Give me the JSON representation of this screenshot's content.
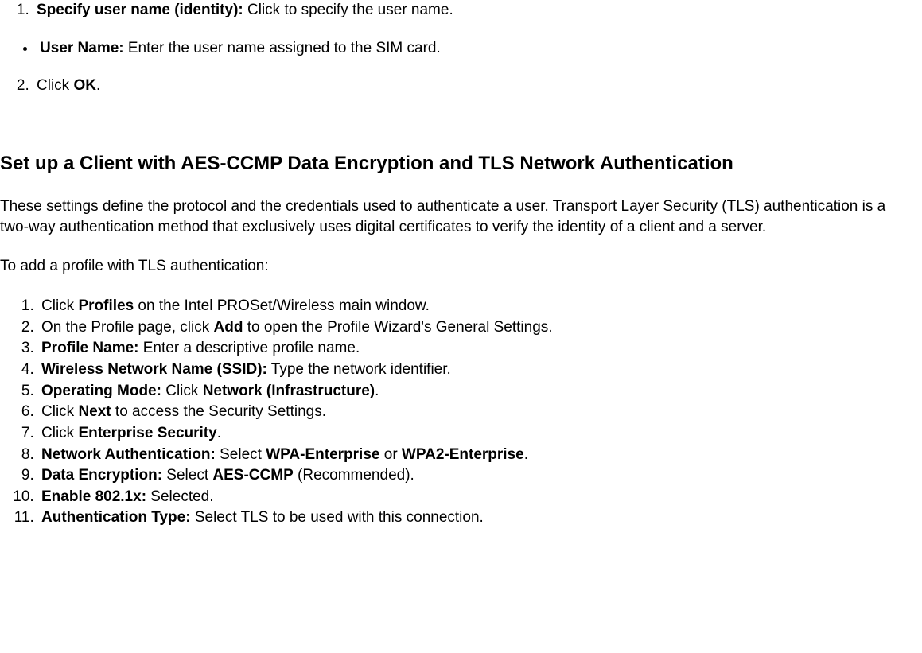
{
  "top_list": {
    "item1_bold": "Specify user name (identity):",
    "item1_rest": " Click to specify the user name.",
    "bullet_bold": "User Name:",
    "bullet_rest": " Enter the user name assigned to the SIM card.",
    "item2_pre": "Click ",
    "item2_bold": "OK",
    "item2_post": "."
  },
  "heading": "Set up a Client with AES-CCMP Data Encryption and TLS Network Authentication",
  "intro": "These settings define the protocol and the credentials used to authenticate a user. Transport Layer Security (TLS) authentication is a two-way authentication method that exclusively uses digital certificates to verify the identity of a client and a server.",
  "lead": "To add a profile with TLS authentication:",
  "steps": {
    "s1_a": "Click ",
    "s1_b": "Profiles",
    "s1_c": " on the Intel PROSet/Wireless main window.",
    "s2_a": "On the Profile page, click ",
    "s2_b": "Add",
    "s2_c": " to open the Profile Wizard's General Settings.",
    "s3_b": "Profile Name:",
    "s3_c": " Enter a descriptive profile name.",
    "s4_b": "Wireless Network Name (SSID):",
    "s4_c": " Type the network identifier.",
    "s5_b": "Operating Mode:",
    "s5_c": " Click ",
    "s5_d": "Network (Infrastructure)",
    "s5_e": ".",
    "s6_a": "Click ",
    "s6_b": "Next",
    "s6_c": " to access the Security Settings.",
    "s7_a": "Click ",
    "s7_b": "Enterprise Security",
    "s7_c": ".",
    "s8_b": "Network Authentication:",
    "s8_c": " Select ",
    "s8_d": "WPA-Enterprise",
    "s8_e": " or ",
    "s8_f": "WPA2-Enterprise",
    "s8_g": ".",
    "s9_b": "Data Encryption:",
    "s9_c": " Select ",
    "s9_d": "AES-CCMP",
    "s9_e": " (Recommended).",
    "s10_b": "Enable 802.1x:",
    "s10_c": " Selected.",
    "s11_b": "Authentication Type:",
    "s11_c": " Select TLS to be used with this connection."
  }
}
